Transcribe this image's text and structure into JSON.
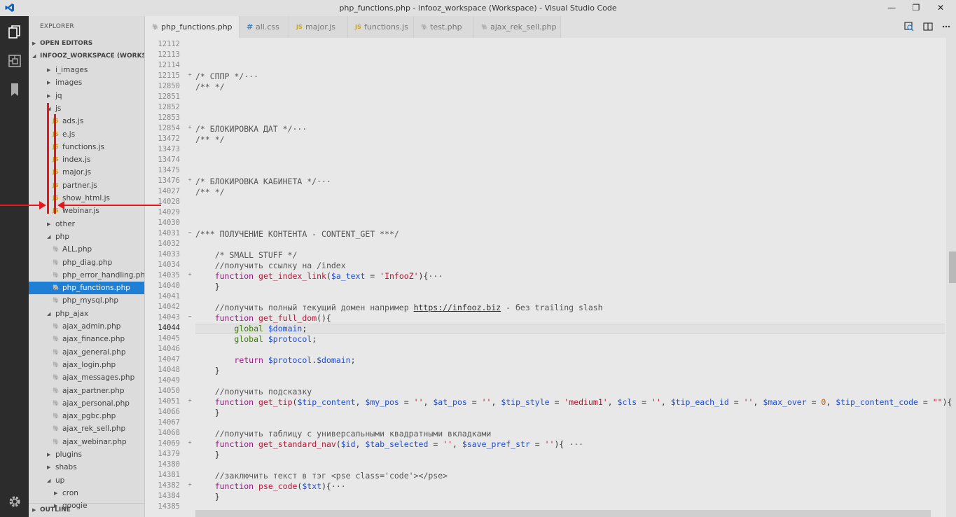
{
  "window": {
    "title": "php_functions.php - infooz_workspace (Workspace) - Visual Studio Code",
    "min_label": "—",
    "max_label": "❐",
    "close_label": "✕"
  },
  "explorer": {
    "header": "EXPLORER",
    "open_editors": "OPEN EDITORS",
    "workspace": "INFOOZ_WORKSPACE (WORKSP...",
    "outline": "OUTLINE"
  },
  "tree": [
    {
      "label": "i_images",
      "type": "folder",
      "expanded": false,
      "depth": 1
    },
    {
      "label": "images",
      "type": "folder",
      "expanded": false,
      "depth": 1
    },
    {
      "label": "jq",
      "type": "folder",
      "expanded": false,
      "depth": 1
    },
    {
      "label": "js",
      "type": "folder",
      "expanded": true,
      "depth": 1
    },
    {
      "label": "ads.js",
      "type": "js",
      "depth": 2
    },
    {
      "label": "e.js",
      "type": "js",
      "depth": 2
    },
    {
      "label": "functions.js",
      "type": "js",
      "depth": 2
    },
    {
      "label": "index.js",
      "type": "js",
      "depth": 2
    },
    {
      "label": "major.js",
      "type": "js",
      "depth": 2
    },
    {
      "label": "partner.js",
      "type": "js",
      "depth": 2
    },
    {
      "label": "show_html.js",
      "type": "js",
      "depth": 2
    },
    {
      "label": "webinar.js",
      "type": "js",
      "depth": 2
    },
    {
      "label": "other",
      "type": "folder",
      "expanded": false,
      "depth": 1
    },
    {
      "label": "php",
      "type": "folder",
      "expanded": true,
      "depth": 1
    },
    {
      "label": "ALL.php",
      "type": "php",
      "depth": 2
    },
    {
      "label": "php_diag.php",
      "type": "php",
      "depth": 2
    },
    {
      "label": "php_error_handling.php",
      "type": "php",
      "depth": 2
    },
    {
      "label": "php_functions.php",
      "type": "php",
      "depth": 2,
      "selected": true
    },
    {
      "label": "php_mysql.php",
      "type": "php",
      "depth": 2
    },
    {
      "label": "php_ajax",
      "type": "folder",
      "expanded": true,
      "depth": 1
    },
    {
      "label": "ajax_admin.php",
      "type": "php",
      "depth": 2
    },
    {
      "label": "ajax_finance.php",
      "type": "php",
      "depth": 2
    },
    {
      "label": "ajax_general.php",
      "type": "php",
      "depth": 2
    },
    {
      "label": "ajax_login.php",
      "type": "php",
      "depth": 2
    },
    {
      "label": "ajax_messages.php",
      "type": "php",
      "depth": 2
    },
    {
      "label": "ajax_partner.php",
      "type": "php",
      "depth": 2
    },
    {
      "label": "ajax_personal.php",
      "type": "php",
      "depth": 2
    },
    {
      "label": "ajax_pgbc.php",
      "type": "php",
      "depth": 2
    },
    {
      "label": "ajax_rek_sell.php",
      "type": "php",
      "depth": 2
    },
    {
      "label": "ajax_webinar.php",
      "type": "php",
      "depth": 2
    },
    {
      "label": "plugins",
      "type": "folder",
      "expanded": false,
      "depth": 1
    },
    {
      "label": "shabs",
      "type": "folder",
      "expanded": false,
      "depth": 1
    },
    {
      "label": "up",
      "type": "folder",
      "expanded": true,
      "depth": 1
    },
    {
      "label": "cron",
      "type": "folder",
      "expanded": false,
      "depth": 2
    },
    {
      "label": "google",
      "type": "folder",
      "expanded": false,
      "depth": 2
    }
  ],
  "tabs": [
    {
      "label": "php_functions.php",
      "type": "php",
      "active": true
    },
    {
      "label": "all.css",
      "type": "css",
      "active": false
    },
    {
      "label": "major.js",
      "type": "js",
      "active": false
    },
    {
      "label": "functions.js",
      "type": "js",
      "active": false
    },
    {
      "label": "test.php",
      "type": "php",
      "active": false
    },
    {
      "label": "ajax_rek_sell.php",
      "type": "php",
      "active": false
    }
  ],
  "icon_glyphs": {
    "js": "JS",
    "php": "🐘",
    "css": "#"
  },
  "editor": {
    "current_line": "14044",
    "lines": [
      {
        "n": "12112",
        "f": "",
        "t": []
      },
      {
        "n": "12113",
        "f": "",
        "t": []
      },
      {
        "n": "12114",
        "f": "",
        "t": []
      },
      {
        "n": "12115",
        "f": "+",
        "t": [
          [
            "cmt",
            "/* СППР */"
          ],
          [
            "cmt",
            "···"
          ]
        ]
      },
      {
        "n": "12850",
        "f": "",
        "t": [
          [
            "cmt",
            "/** */"
          ]
        ]
      },
      {
        "n": "12851",
        "f": "",
        "t": []
      },
      {
        "n": "12852",
        "f": "",
        "t": []
      },
      {
        "n": "12853",
        "f": "",
        "t": []
      },
      {
        "n": "12854",
        "f": "+",
        "t": [
          [
            "cmt",
            "/* БЛОКИРОВКА ДАТ */"
          ],
          [
            "cmt",
            "···"
          ]
        ]
      },
      {
        "n": "13472",
        "f": "",
        "t": [
          [
            "cmt",
            "/** */"
          ]
        ]
      },
      {
        "n": "13473",
        "f": "",
        "t": []
      },
      {
        "n": "13474",
        "f": "",
        "t": []
      },
      {
        "n": "13475",
        "f": "",
        "t": []
      },
      {
        "n": "13476",
        "f": "+",
        "t": [
          [
            "cmt",
            "/* БЛОКИРОВКА КАБИНЕТА */"
          ],
          [
            "cmt",
            "···"
          ]
        ]
      },
      {
        "n": "14027",
        "f": "",
        "t": [
          [
            "cmt",
            "/** */"
          ]
        ]
      },
      {
        "n": "14028",
        "f": "",
        "t": []
      },
      {
        "n": "14029",
        "f": "",
        "t": []
      },
      {
        "n": "14030",
        "f": "",
        "t": []
      },
      {
        "n": "14031",
        "f": "−",
        "t": [
          [
            "cmt",
            "/*** ПОЛУЧЕНИЕ КОНТЕНТА - CONTENT_GET ***/"
          ]
        ]
      },
      {
        "n": "14032",
        "f": "",
        "t": []
      },
      {
        "n": "14033",
        "f": "",
        "t": [
          [
            "",
            "    "
          ],
          [
            "cmt",
            "/* SMALL STUFF */"
          ]
        ]
      },
      {
        "n": "14034",
        "f": "",
        "t": [
          [
            "",
            "    "
          ],
          [
            "cmt",
            "//получить ссылку на /index"
          ]
        ]
      },
      {
        "n": "14035",
        "f": "+",
        "t": [
          [
            "",
            "    "
          ],
          [
            "kw",
            "function"
          ],
          [
            "",
            " "
          ],
          [
            "fn",
            "get_index_link"
          ],
          [
            "",
            "("
          ],
          [
            "var",
            "$a_text"
          ],
          [
            "",
            " = "
          ],
          [
            "str",
            "'InfooZ'"
          ],
          [
            "",
            "){"
          ],
          [
            "cmt",
            "···"
          ]
        ]
      },
      {
        "n": "14040",
        "f": "",
        "t": [
          [
            "",
            "    }"
          ]
        ]
      },
      {
        "n": "14041",
        "f": "",
        "t": []
      },
      {
        "n": "14042",
        "f": "",
        "t": [
          [
            "",
            "    "
          ],
          [
            "cmt",
            "//получить полный текущий домен например "
          ],
          [
            "ul",
            "https://infooz.biz"
          ],
          [
            "cmt",
            " - без trailing slash"
          ]
        ]
      },
      {
        "n": "14043",
        "f": "−",
        "t": [
          [
            "",
            "    "
          ],
          [
            "kw",
            "function"
          ],
          [
            "",
            " "
          ],
          [
            "fn",
            "get_full_dom"
          ],
          [
            "",
            "(){"
          ]
        ]
      },
      {
        "n": "14044",
        "f": "",
        "t": [
          [
            "",
            "        "
          ],
          [
            "gl",
            "global"
          ],
          [
            "",
            " "
          ],
          [
            "var",
            "$domain"
          ],
          [
            "",
            ";"
          ]
        ]
      },
      {
        "n": "14045",
        "f": "",
        "t": [
          [
            "",
            "        "
          ],
          [
            "gl",
            "global"
          ],
          [
            "",
            " "
          ],
          [
            "var",
            "$protocol"
          ],
          [
            "",
            ";"
          ]
        ]
      },
      {
        "n": "14046",
        "f": "",
        "t": []
      },
      {
        "n": "14047",
        "f": "",
        "t": [
          [
            "",
            "        "
          ],
          [
            "kw",
            "return"
          ],
          [
            "",
            " "
          ],
          [
            "var",
            "$protocol"
          ],
          [
            "",
            "."
          ],
          [
            "var",
            "$domain"
          ],
          [
            "",
            ";"
          ]
        ]
      },
      {
        "n": "14048",
        "f": "",
        "t": [
          [
            "",
            "    }"
          ]
        ]
      },
      {
        "n": "14049",
        "f": "",
        "t": []
      },
      {
        "n": "14050",
        "f": "",
        "t": [
          [
            "",
            "    "
          ],
          [
            "cmt",
            "//получить подсказку"
          ]
        ]
      },
      {
        "n": "14051",
        "f": "+",
        "t": [
          [
            "",
            "    "
          ],
          [
            "kw",
            "function"
          ],
          [
            "",
            " "
          ],
          [
            "fn",
            "get_tip"
          ],
          [
            "",
            "("
          ],
          [
            "var",
            "$tip_content"
          ],
          [
            "",
            ", "
          ],
          [
            "var",
            "$my_pos"
          ],
          [
            "",
            " = "
          ],
          [
            "str",
            "''"
          ],
          [
            "",
            ", "
          ],
          [
            "var",
            "$at_pos"
          ],
          [
            "",
            " = "
          ],
          [
            "str",
            "''"
          ],
          [
            "",
            ", "
          ],
          [
            "var",
            "$tip_style"
          ],
          [
            "",
            " = "
          ],
          [
            "str",
            "'medium1'"
          ],
          [
            "",
            ", "
          ],
          [
            "var",
            "$cls"
          ],
          [
            "",
            " = "
          ],
          [
            "str",
            "''"
          ],
          [
            "",
            ", "
          ],
          [
            "var",
            "$tip_each_id"
          ],
          [
            "",
            " = "
          ],
          [
            "str",
            "''"
          ],
          [
            "",
            ", "
          ],
          [
            "var",
            "$max_over"
          ],
          [
            "",
            " = "
          ],
          [
            "num",
            "0"
          ],
          [
            "",
            ", "
          ],
          [
            "var",
            "$tip_content_code"
          ],
          [
            "",
            " = "
          ],
          [
            "str",
            "\"\""
          ],
          [
            "",
            "){"
          ]
        ]
      },
      {
        "n": "14066",
        "f": "",
        "t": [
          [
            "",
            "    }"
          ]
        ]
      },
      {
        "n": "14067",
        "f": "",
        "t": []
      },
      {
        "n": "14068",
        "f": "",
        "t": [
          [
            "",
            "    "
          ],
          [
            "cmt",
            "//получить таблицу с универсальными квадратными вкладками"
          ]
        ]
      },
      {
        "n": "14069",
        "f": "+",
        "t": [
          [
            "",
            "    "
          ],
          [
            "kw",
            "function"
          ],
          [
            "",
            " "
          ],
          [
            "fn",
            "get_standard_nav"
          ],
          [
            "",
            "("
          ],
          [
            "var",
            "$id"
          ],
          [
            "",
            ", "
          ],
          [
            "var",
            "$tab_selected"
          ],
          [
            "",
            " = "
          ],
          [
            "str",
            "''"
          ],
          [
            "",
            ", "
          ],
          [
            "var",
            "$save_pref_str"
          ],
          [
            "",
            " = "
          ],
          [
            "str",
            "''"
          ],
          [
            "",
            "){ "
          ],
          [
            "cmt",
            "···"
          ]
        ]
      },
      {
        "n": "14379",
        "f": "",
        "t": [
          [
            "",
            "    }"
          ]
        ]
      },
      {
        "n": "14380",
        "f": "",
        "t": []
      },
      {
        "n": "14381",
        "f": "",
        "t": [
          [
            "",
            "    "
          ],
          [
            "cmt",
            "//заключить текст в тэг <pse class='code'></pse>"
          ]
        ]
      },
      {
        "n": "14382",
        "f": "+",
        "t": [
          [
            "",
            "    "
          ],
          [
            "kw",
            "function"
          ],
          [
            "",
            " "
          ],
          [
            "fn",
            "pse_code"
          ],
          [
            "",
            "("
          ],
          [
            "var",
            "$txt"
          ],
          [
            "",
            "){"
          ],
          [
            "cmt",
            "···"
          ]
        ]
      },
      {
        "n": "14384",
        "f": "",
        "t": [
          [
            "",
            "    }"
          ]
        ]
      },
      {
        "n": "14385",
        "f": "",
        "t": []
      }
    ]
  },
  "colors": {
    "selection": "#1e7fd4",
    "annotation_red": "#e8161a",
    "activity_bar": "#2c2c2c"
  }
}
